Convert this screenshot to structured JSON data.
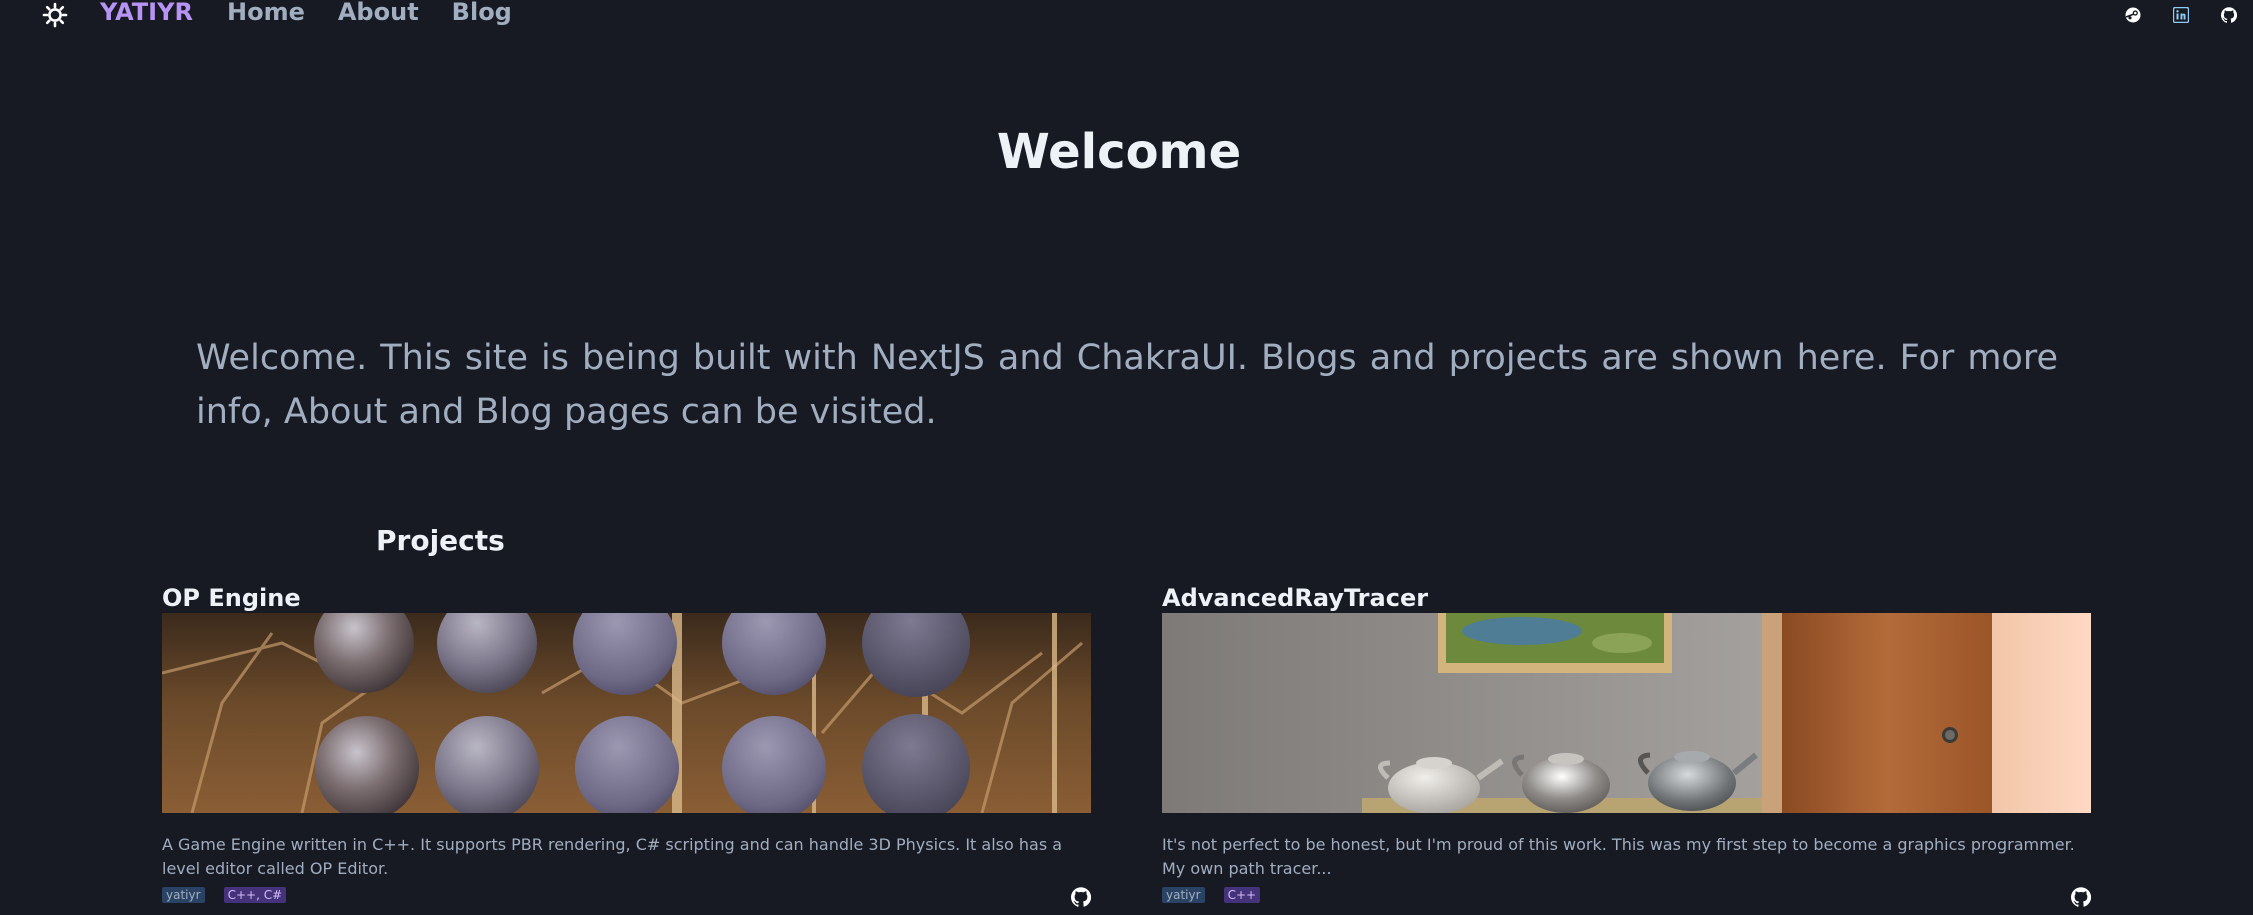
{
  "navbar": {
    "brand": "YATIYR",
    "links": [
      "Home",
      "About",
      "Blog"
    ],
    "socials": [
      "steam-icon",
      "linkedin-icon",
      "github-icon"
    ]
  },
  "hero": {
    "title": "Welcome",
    "intro": "Welcome. This site is being built with NextJS and ChakraUI. Blogs and projects are shown here. For more info, About and Blog pages can be visited."
  },
  "projects": {
    "heading": "Projects",
    "items": [
      {
        "title": "OP Engine",
        "description": "A Game Engine written in C++. It supports PBR rendering, C# scripting and can handle 3D Physics. It also has a level editor called OP Editor.",
        "author": "yatiyr",
        "languages": "C++, C#"
      },
      {
        "title": "AdvancedRayTracer",
        "description": "It's not perfect to be honest, but I'm proud of this work. This was my first step to become a graphics programmer. My own path tracer...",
        "author": "yatiyr",
        "languages": "C++"
      }
    ]
  },
  "colors": {
    "background": "#171923",
    "brand": "#b794f4",
    "muted_text": "#a0aec0",
    "heading_text": "#edf2f7"
  }
}
